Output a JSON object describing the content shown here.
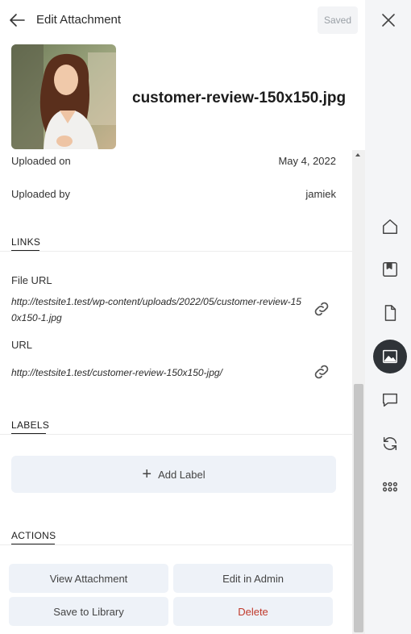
{
  "header": {
    "title": "Edit Attachment",
    "saved_label": "Saved"
  },
  "attachment": {
    "filename": "customer-review-150x150.jpg",
    "uploaded_on_label": "Uploaded on",
    "uploaded_on_value": "May 4, 2022",
    "uploaded_by_label": "Uploaded by",
    "uploaded_by_value": "jamiek"
  },
  "links": {
    "heading": "LINKS",
    "file_url_label": "File URL",
    "file_url": "http://testsite1.test/wp-content/uploads/2022/05/customer-review-150x150-1.jpg",
    "url_label": "URL",
    "url": "http://testsite1.test/customer-review-150x150-jpg/"
  },
  "labels": {
    "heading": "LABELS",
    "add_label": "Add Label"
  },
  "actions": {
    "heading": "ACTIONS",
    "view_attachment": "View Attachment",
    "edit_in_admin": "Edit in Admin",
    "save_to_library": "Save to Library",
    "delete": "Delete"
  },
  "rail": {
    "items": [
      "home-icon",
      "bookmark-icon",
      "document-icon",
      "image-icon",
      "comment-icon",
      "refresh-icon",
      "apps-grid-icon"
    ],
    "active": "image-icon"
  },
  "colors": {
    "accent_dark": "#2f3338",
    "button_bg": "#eef2f8",
    "delete_red": "#c0392b"
  }
}
